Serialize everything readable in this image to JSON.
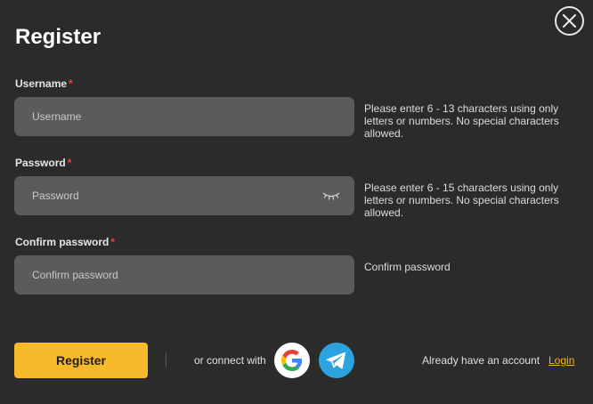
{
  "dialog": {
    "title": "Register"
  },
  "form": {
    "username": {
      "label": "Username",
      "required_mark": "*",
      "placeholder": "Username",
      "value": "",
      "hint": "Please enter 6 - 13 characters using only letters or numbers. No special characters allowed."
    },
    "password": {
      "label": "Password",
      "required_mark": "*",
      "placeholder": "Password",
      "value": "",
      "hint": "Please enter 6 - 15 characters using only letters or numbers. No special characters allowed.",
      "toggle_icon": "eye-closed-icon"
    },
    "confirm_password": {
      "label": "Confirm password",
      "required_mark": "*",
      "placeholder": "Confirm password",
      "value": "",
      "hint": "Confirm password"
    }
  },
  "footer": {
    "register_label": "Register",
    "connect_text": "or connect with",
    "social": [
      {
        "name": "google",
        "icon": "google-icon",
        "color": "#ffffff"
      },
      {
        "name": "telegram",
        "icon": "telegram-icon",
        "color": "#2aa3de"
      }
    ],
    "account_text": "Already have an account",
    "login_label": "Login"
  },
  "colors": {
    "background": "#2b2b2b",
    "field": "#5b5b5b",
    "accent": "#f8b92a",
    "required": "#e8443a",
    "link": "#f5b323"
  }
}
